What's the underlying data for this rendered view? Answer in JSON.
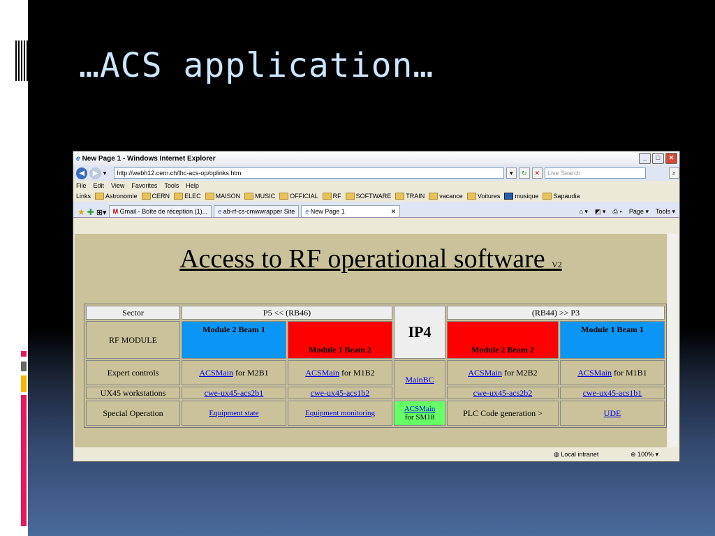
{
  "slide": {
    "title": "…ACS application…",
    "colors": {
      "accent_pink": "#e9185b",
      "accent_yellow": "#f7b500",
      "title_color": "#cde6ff"
    }
  },
  "browser": {
    "window_title": "New Page 1 - Windows Internet Explorer",
    "url": "http://webh12.cern.ch/lhc-acs-op/oplinks.htm",
    "search_placeholder": "Live Search",
    "menu": [
      "File",
      "Edit",
      "View",
      "Favorites",
      "Tools",
      "Help"
    ],
    "links_label": "Links",
    "links": [
      "Astronomie",
      "CERN",
      "ELEC",
      "MAISON",
      "MUSIC",
      "OFFICIAL",
      "RF",
      "SOFTWARE",
      "TRAIN",
      "vacance",
      "Voitures",
      "musique",
      "Sapaudia"
    ],
    "tabs": [
      "Gmail - Boîte de réception (1)...",
      "ab-rf-cs-cmwwrapper Site",
      "New Page 1"
    ],
    "toolbar_right": [
      "Page ▾",
      "Tools ▾"
    ],
    "status": {
      "zone": "Local intranet",
      "zoom": "100%"
    }
  },
  "page": {
    "heading": "Access to RF operational software",
    "version": "V2",
    "table": {
      "sector_label": "Sector",
      "left_sector": "P5 <<  (RB46)",
      "right_sector": "(RB44)  >> P3",
      "ip_label": "IP4",
      "rf_module_label": "RF MODULE",
      "modules": [
        "Module 2 Beam 1",
        "Module 1 Beam 2",
        "Module 2 Beam 2",
        "Module 1 Beam 1"
      ],
      "expert_label": "Expert controls",
      "expert": [
        {
          "link": "ACSMain",
          "suffix": " for M2B1"
        },
        {
          "link": "ACSMain",
          "suffix": "  for M1B2"
        },
        {
          "link": "ACSMain",
          "suffix": " for M2B2"
        },
        {
          "link": "ACSMain",
          "suffix": " for M1B1"
        }
      ],
      "mainbc": "MainBC",
      "ux_label": "UX45 workstations",
      "ux": [
        "cwe-ux45-acs2b1",
        "cwe-ux45-acs1b2",
        "cwe-ux45-acs2b2",
        "cwe-ux45-acs1b1"
      ],
      "special_label": "Special Operation",
      "special_left": [
        "Equipment state",
        "Equipment monitoring"
      ],
      "special_mid_link": "ACSMain",
      "special_mid_text": "for SM18",
      "special_right": [
        "PLC Code generation >",
        "UDE"
      ],
      "colors": {
        "blue": "#0b95f5",
        "red": "#ff0000",
        "green": "#66ff66",
        "bg": "#c9c29a"
      }
    }
  }
}
